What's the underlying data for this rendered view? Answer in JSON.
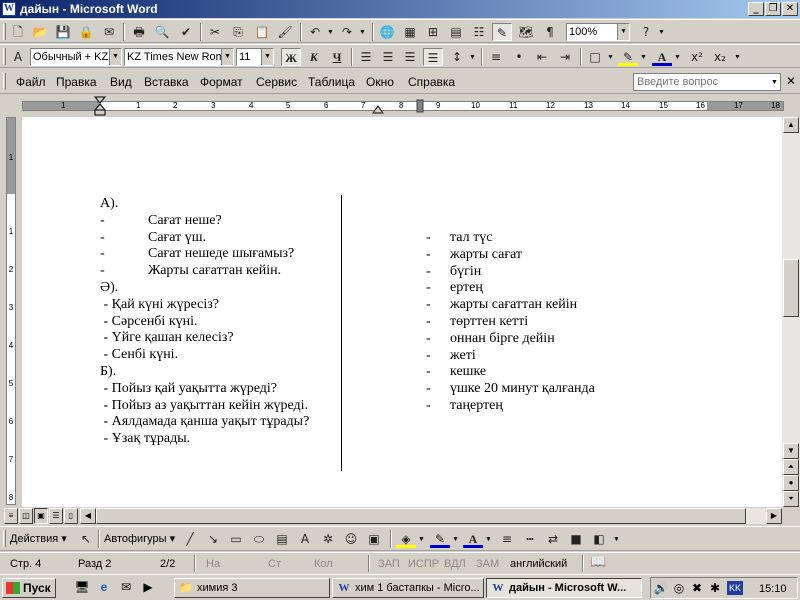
{
  "window": {
    "app_icon": "W",
    "title": "дайын - Microsoft Word",
    "minimize": "_",
    "restore": "❐",
    "close": "✕"
  },
  "doc_controls": {
    "restore": "❐",
    "close": "✕"
  },
  "formatting": {
    "style": "Обычный + KZ",
    "font": "KZ Times New Roma",
    "size": "11",
    "bold": "Ж",
    "italic": "К",
    "underline": "Ч"
  },
  "standard": {
    "zoom": "100%"
  },
  "menu": {
    "items": [
      {
        "label": "Файл",
        "key": "Ф"
      },
      {
        "label": "Правка",
        "key": "П"
      },
      {
        "label": "Вид",
        "key": "В"
      },
      {
        "label": "Вставка",
        "key": "с"
      },
      {
        "label": "Формат",
        "key": "о"
      },
      {
        "label": "Сервис",
        "key": "е"
      },
      {
        "label": "Таблица",
        "key": "Т"
      },
      {
        "label": "Окно",
        "key": "О"
      },
      {
        "label": "Справка",
        "key": "С"
      }
    ],
    "ask_placeholder": "Введите вопрос"
  },
  "ruler": {
    "tab_selector": "L",
    "h_numbers": [
      "1",
      "1",
      "2",
      "3",
      "4",
      "5",
      "6",
      "7",
      "8",
      "9",
      "10",
      "11",
      "12",
      "13",
      "14",
      "15",
      "16",
      "17",
      "18"
    ],
    "v_numbers": [
      "1",
      "1",
      "2",
      "3",
      "4",
      "5",
      "6",
      "7",
      "8"
    ]
  },
  "document": {
    "left_column": [
      {
        "bullet": "",
        "text": "А)."
      },
      {
        "bullet": "-",
        "text": "Сағат неше?"
      },
      {
        "bullet": "-",
        "text": "Сағат үш."
      },
      {
        "bullet": "-",
        "text": "Сағат нешеде шығамыз?"
      },
      {
        "bullet": "-",
        "text": "Жарты сағаттан кейін."
      },
      {
        "bullet": "",
        "text": "Ә)."
      },
      {
        "bullet": "",
        "text": " - Қай күні жүресіз?"
      },
      {
        "bullet": "",
        "text": " - Сәрсенбі күні."
      },
      {
        "bullet": "",
        "text": " - Үйге қашан келесіз?"
      },
      {
        "bullet": "",
        "text": " - Сенбі күні."
      },
      {
        "bullet": "",
        "text": "Б)."
      },
      {
        "bullet": "",
        "text": " - Пойыз қай уақытта жүреді?"
      },
      {
        "bullet": "",
        "text": " - Пойыз аз уақыттан кейін жүреді."
      },
      {
        "bullet": "",
        "text": " - Аялдамада қанша уақыт тұрады?"
      },
      {
        "bullet": "",
        "text": " - Ұзақ тұрады."
      }
    ],
    "right_column": [
      {
        "bullet": "-",
        "text": "тал түс"
      },
      {
        "bullet": "-",
        "text": "жарты сағат"
      },
      {
        "bullet": "-",
        "text": "бүгін"
      },
      {
        "bullet": "-",
        "text": "ертең"
      },
      {
        "bullet": "-",
        "text": "жарты сағаттан кейін"
      },
      {
        "bullet": "-",
        "text": "төрттен кетті"
      },
      {
        "bullet": "-",
        "text": "оннан бірге дейін"
      },
      {
        "bullet": "-",
        "text": "жеті"
      },
      {
        "bullet": "-",
        "text": "кешке"
      },
      {
        "bullet": "-",
        "text": "үшке 20 минут қалғанда"
      },
      {
        "bullet": "-",
        "text": "таңертең"
      }
    ]
  },
  "drawing": {
    "actions": "Действия",
    "autoshapes": "Автофигуры"
  },
  "status": {
    "page": "Стр. 4",
    "section": "Разд 2",
    "pages": "2/2",
    "at": "На",
    "line": "Ст",
    "col": "Кол",
    "rec": "ЗАП",
    "trk": "ИСПР",
    "ext": "ВДЛ",
    "ovr": "ЗАМ",
    "language": "английский"
  },
  "taskbar": {
    "start": "Пуск",
    "buttons": [
      {
        "label": "химия 3",
        "active": false
      },
      {
        "label": "хим 1 бастапкы - Micro...",
        "active": false
      },
      {
        "label": "дайын - Microsoft W...",
        "active": true
      }
    ],
    "lang": "KK",
    "clock": "15:10"
  },
  "colors": {
    "title_start": "#0a246a",
    "title_end": "#a6caf0",
    "chrome": "#d4d0c8"
  }
}
